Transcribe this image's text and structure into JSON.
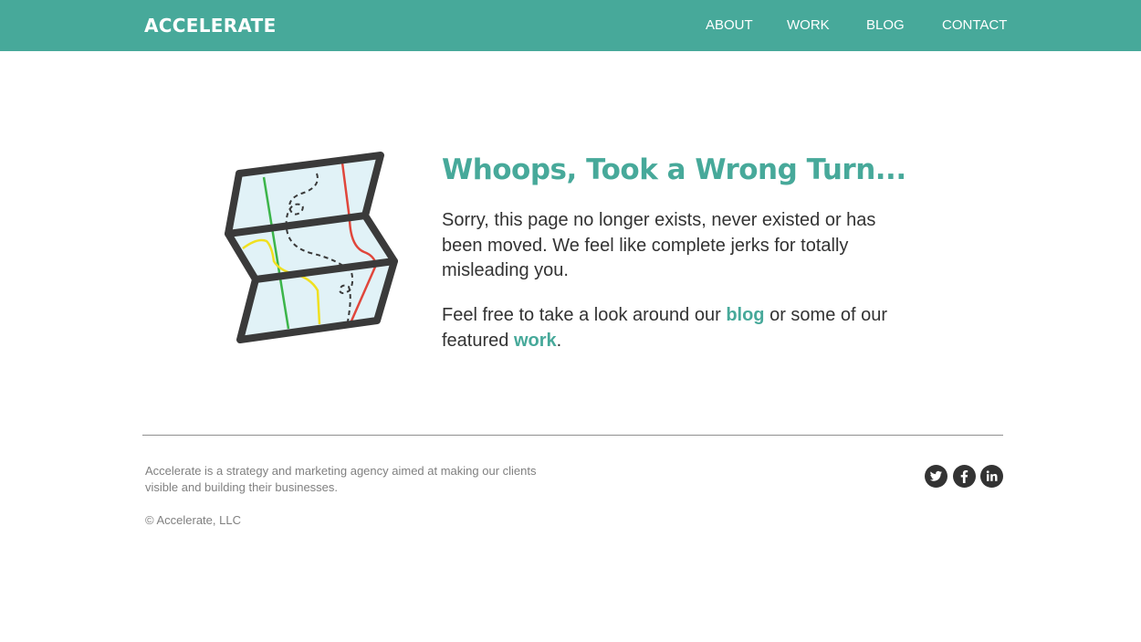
{
  "header": {
    "logo": "ACCELERATE",
    "nav": [
      {
        "label": "ABOUT"
      },
      {
        "label": "WORK"
      },
      {
        "label": "BLOG"
      },
      {
        "label": "CONTACT"
      }
    ]
  },
  "main": {
    "illustration_icon": "folded-map-icon",
    "headline": "Whoops, Took a Wrong Turn...",
    "paragraph1": "Sorry, this page no longer exists, never existed or has been moved. We feel like complete jerks for totally misleading you.",
    "paragraph2": {
      "before": "Feel free to take a look around our ",
      "blog_link": "blog",
      "middle": " or some of our featured ",
      "work_link": "work",
      "after": "."
    }
  },
  "footer": {
    "about": "Accelerate is a strategy and marketing agency aimed at making our clients visible and building their businesses.",
    "copyright": "© Accelerate, LLC",
    "social": [
      {
        "icon": "twitter-icon"
      },
      {
        "icon": "facebook-icon"
      },
      {
        "icon": "linkedin-icon"
      }
    ]
  },
  "colors": {
    "brand": "#47a99a",
    "text": "#333333",
    "muted": "#808080",
    "map_fill": "#e1f2f7",
    "route_red": "#e0463b",
    "route_green": "#3cb54a",
    "route_yellow": "#f0e020"
  }
}
